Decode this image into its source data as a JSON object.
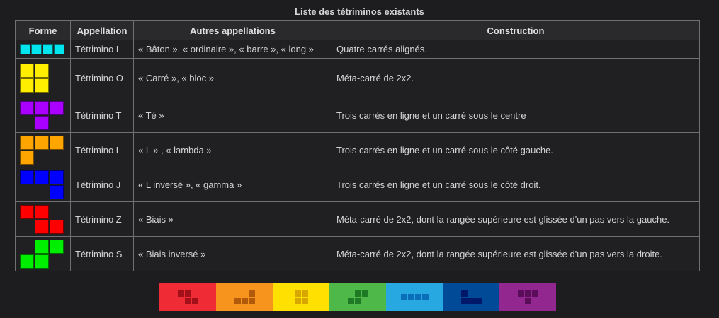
{
  "caption": "Liste des tétriminos existants",
  "headers": [
    "Forme",
    "Appellation",
    "Autres appellations",
    "Construction"
  ],
  "rows": [
    {
      "name": "Tétrimino I",
      "other": "« Bâton », « ordinaire », « barre », « long »",
      "construction": "Quatre carrés alignés.",
      "color": "#00e5ee",
      "shape": [
        [
          1,
          1,
          1,
          1
        ]
      ],
      "icon": "tetromino-i-icon"
    },
    {
      "name": "Tétrimino O",
      "other": "« Carré », « bloc »",
      "construction": "Méta-carré de 2x2.",
      "color": "#ffee00",
      "shape": [
        [
          1,
          1
        ],
        [
          1,
          1
        ]
      ],
      "icon": "tetromino-o-icon"
    },
    {
      "name": "Tétrimino T",
      "other": "« Té »",
      "construction": "Trois carrés en ligne et un carré sous le centre",
      "color": "#aa00ff",
      "shape": [
        [
          1,
          1,
          1
        ],
        [
          0,
          1,
          0
        ]
      ],
      "icon": "tetromino-t-icon"
    },
    {
      "name": "Tétrimino L",
      "other": "« L » , « lambda »",
      "construction": "Trois carrés en ligne et un carré sous le côté gauche.",
      "color": "#ffa500",
      "shape": [
        [
          1,
          1,
          1
        ],
        [
          1,
          0,
          0
        ]
      ],
      "icon": "tetromino-l-icon"
    },
    {
      "name": "Tétrimino J",
      "other": "« L inversé », « gamma »",
      "construction": "Trois carrés en ligne et un carré sous le côté droit.",
      "color": "#0000ff",
      "shape": [
        [
          1,
          1,
          1
        ],
        [
          0,
          0,
          1
        ]
      ],
      "icon": "tetromino-j-icon"
    },
    {
      "name": "Tétrimino Z",
      "other": "« Biais »",
      "construction": "Méta-carré de 2x2, dont la rangée supérieure est glissée d'un pas vers la gauche.",
      "color": "#ff0000",
      "shape": [
        [
          1,
          1,
          0
        ],
        [
          0,
          1,
          1
        ]
      ],
      "icon": "tetromino-z-icon"
    },
    {
      "name": "Tétrimino S",
      "other": "« Biais inversé »",
      "construction": "Méta-carré de 2x2, dont la rangée supérieure est glissée d'un pas vers la droite.",
      "color": "#00ee00",
      "shape": [
        [
          0,
          1,
          1
        ],
        [
          1,
          1,
          0
        ]
      ],
      "icon": "tetromino-s-icon"
    }
  ],
  "banner": [
    {
      "bg": "#ef2b36",
      "fg": "#a3101a",
      "shape": [
        [
          1,
          1,
          0
        ],
        [
          0,
          1,
          1
        ]
      ],
      "icon": "z-piece-icon"
    },
    {
      "bg": "#f7941e",
      "fg": "#b05a0a",
      "shape": [
        [
          0,
          0,
          1
        ],
        [
          1,
          1,
          1
        ]
      ],
      "icon": "l-piece-icon"
    },
    {
      "bg": "#ffe001",
      "fg": "#d8a600",
      "shape": [
        [
          1,
          1
        ],
        [
          1,
          1
        ]
      ],
      "icon": "o-piece-icon"
    },
    {
      "bg": "#4eb848",
      "fg": "#1f7a25",
      "shape": [
        [
          0,
          1,
          1
        ],
        [
          1,
          1,
          0
        ]
      ],
      "icon": "s-piece-icon"
    },
    {
      "bg": "#28a8e1",
      "fg": "#0a6fb8",
      "shape": [
        [
          1,
          1,
          1,
          1
        ]
      ],
      "icon": "i-piece-icon"
    },
    {
      "bg": "#004a98",
      "fg": "#00186a",
      "shape": [
        [
          1,
          0,
          0
        ],
        [
          1,
          1,
          1
        ]
      ],
      "icon": "j-piece-icon"
    },
    {
      "bg": "#92278f",
      "fg": "#5a0d58",
      "shape": [
        [
          1,
          1,
          1
        ],
        [
          0,
          1,
          0
        ]
      ],
      "icon": "t-piece-icon"
    }
  ]
}
